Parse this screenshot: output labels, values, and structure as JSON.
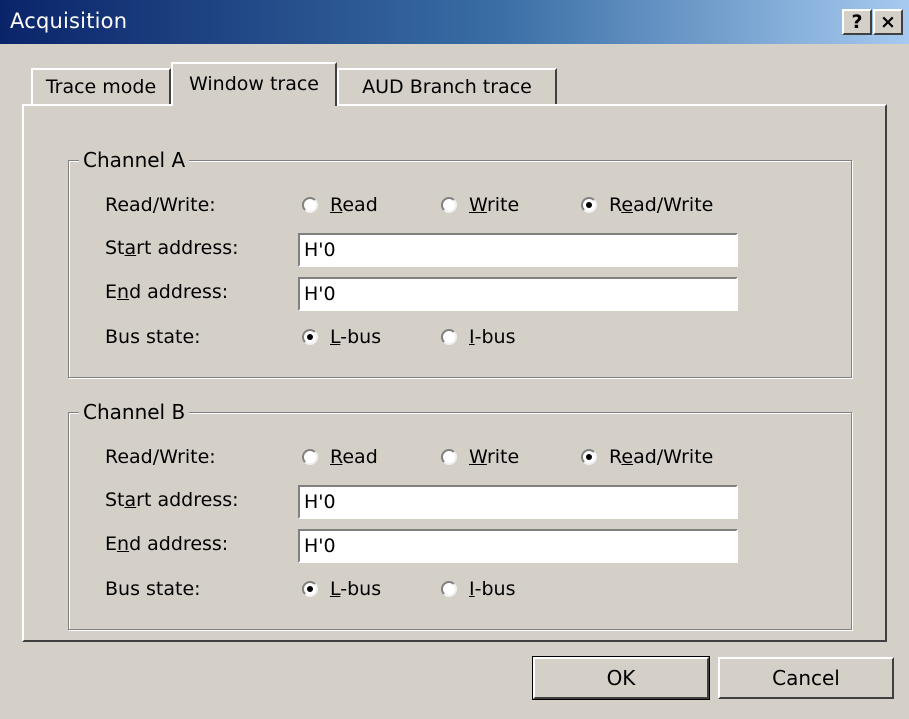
{
  "window": {
    "title": "Acquisition",
    "help_button": "?",
    "close_button": "×"
  },
  "tabs": [
    {
      "label": "Trace mode",
      "selected": false
    },
    {
      "label": "Window trace",
      "selected": true
    },
    {
      "label": "AUD Branch trace",
      "selected": false
    }
  ],
  "channel_a": {
    "legend": "Channel A",
    "rw_label_pre": "Read/Write:",
    "rw_options": [
      {
        "pre": "",
        "ul": "R",
        "post": "ead",
        "checked": false
      },
      {
        "pre": "",
        "ul": "W",
        "post": "rite",
        "checked": false
      },
      {
        "pre": "R",
        "ul": "e",
        "post": "ad/Write",
        "checked": true
      }
    ],
    "start_label": {
      "pre": "St",
      "ul": "a",
      "post": "rt address:"
    },
    "start_value": "H'0",
    "end_label": {
      "pre": "E",
      "ul": "n",
      "post": "d address:"
    },
    "end_value": "H'0",
    "bus_label": "Bus state:",
    "bus_options": [
      {
        "pre": "",
        "ul": "L",
        "post": "-bus",
        "checked": true
      },
      {
        "pre": "",
        "ul": "I",
        "post": "-bus",
        "checked": false
      }
    ]
  },
  "channel_b": {
    "legend": "Channel B",
    "rw_label_pre": "Read/Write:",
    "rw_options": [
      {
        "pre": "",
        "ul": "R",
        "post": "ead",
        "checked": false
      },
      {
        "pre": "",
        "ul": "W",
        "post": "rite",
        "checked": false
      },
      {
        "pre": "R",
        "ul": "e",
        "post": "ad/Write",
        "checked": true
      }
    ],
    "start_label": {
      "pre": "St",
      "ul": "a",
      "post": "rt address:"
    },
    "start_value": "H'0",
    "end_label": {
      "pre": "E",
      "ul": "n",
      "post": "d address:"
    },
    "end_value": "H'0",
    "bus_label": "Bus state:",
    "bus_options": [
      {
        "pre": "",
        "ul": "L",
        "post": "-bus",
        "checked": true
      },
      {
        "pre": "",
        "ul": "I",
        "post": "-bus",
        "checked": false
      }
    ]
  },
  "buttons": {
    "ok": "OK",
    "cancel": "Cancel"
  }
}
